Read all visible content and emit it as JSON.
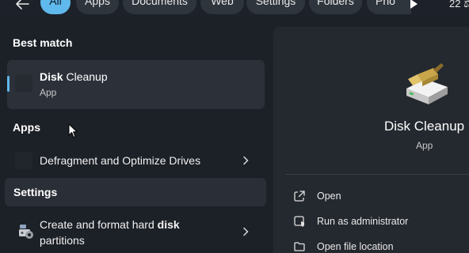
{
  "filters": {
    "back_icon": "arrow-left-icon",
    "tabs": [
      {
        "label": "All",
        "active": true
      },
      {
        "label": "Apps",
        "active": false
      },
      {
        "label": "Documents",
        "active": false
      },
      {
        "label": "Web",
        "active": false
      },
      {
        "label": "Settings",
        "active": false
      },
      {
        "label": "Folders",
        "active": false
      },
      {
        "label": "Pho",
        "active": false
      }
    ],
    "more_icon": "play-icon",
    "count_label": "22 ⚖"
  },
  "results": {
    "best_match_heading": "Best match",
    "best_match": {
      "title_bold": "Disk",
      "title_rest": " Cleanup",
      "subtitle": "App"
    },
    "apps_heading": "Apps",
    "apps": [
      {
        "label": "Defragment and Optimize Drives"
      }
    ],
    "settings_heading": "Settings",
    "settings": [
      {
        "label_part1": "Create and format hard ",
        "label_bold": "disk",
        "label_line2": "partitions"
      }
    ]
  },
  "detail": {
    "icon": "disk-cleanup-icon",
    "title": "Disk Cleanup",
    "subtitle": "App",
    "actions": [
      {
        "label": "Open",
        "icon": "open-external-icon"
      },
      {
        "label": "Run as administrator",
        "icon": "shield-admin-icon"
      },
      {
        "label": "Open file location",
        "icon": "folder-icon"
      }
    ]
  },
  "colors": {
    "accent": "#60b9ec",
    "background": "#1c2027",
    "card": "#2c3139",
    "detail_pane": "#242930"
  }
}
